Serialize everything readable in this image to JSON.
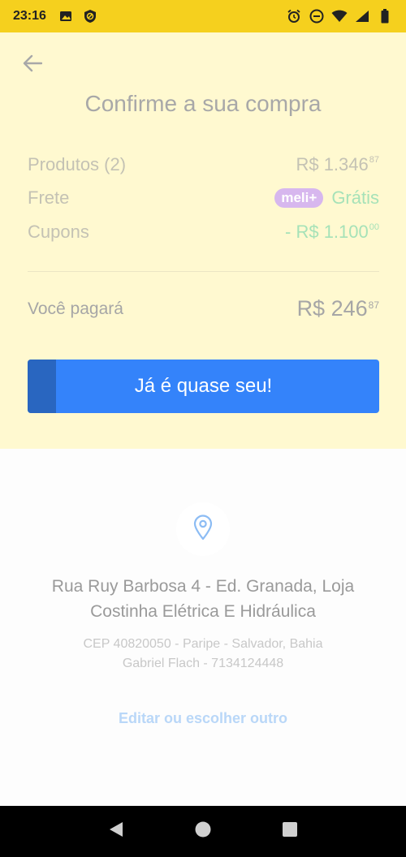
{
  "status_bar": {
    "time": "23:16",
    "left_icons": [
      "image-icon",
      "blocked-icon"
    ],
    "right_icons": [
      "alarm-icon",
      "do-not-disturb-icon",
      "wifi-icon",
      "signal-icon",
      "battery-icon"
    ]
  },
  "header": {
    "back_icon": "arrow-left-icon",
    "title": "Confirme a sua compra"
  },
  "summary": {
    "products": {
      "label": "Produtos (2)",
      "amount": "R$ 1.346",
      "cents": "87"
    },
    "shipping": {
      "label": "Frete",
      "badge": "meli+",
      "value": "Grátis"
    },
    "coupons": {
      "label": "Cupons",
      "amount": "- R$ 1.100",
      "cents": "00"
    },
    "total": {
      "label": "Você pagará",
      "amount": "R$ 246",
      "cents": "87"
    }
  },
  "cta": {
    "label": "Já é quase seu!",
    "progress": 0.08
  },
  "address": {
    "icon": "location-pin-icon",
    "line1": "Rua Ruy Barbosa 4 - Ed. Granada, Loja",
    "line2": "Costinha Elétrica E Hidráulica",
    "detail1": "CEP 40820050 - Paripe - Salvador, Bahia",
    "detail2": "Gabriel Flach - 7134124448",
    "edit_label": "Editar ou escolher outro"
  },
  "nav_bar": {
    "icons": [
      "back-triangle-icon",
      "home-circle-icon",
      "recents-square-icon"
    ]
  },
  "colors": {
    "status_bar": "#f5d01e",
    "panel": "#fff9d0",
    "button": "#3483fa",
    "button_progress": "#2966c0",
    "green": "#a6e2b8",
    "meli_badge": "#d7b7ee",
    "link": "#b9d7f8"
  }
}
